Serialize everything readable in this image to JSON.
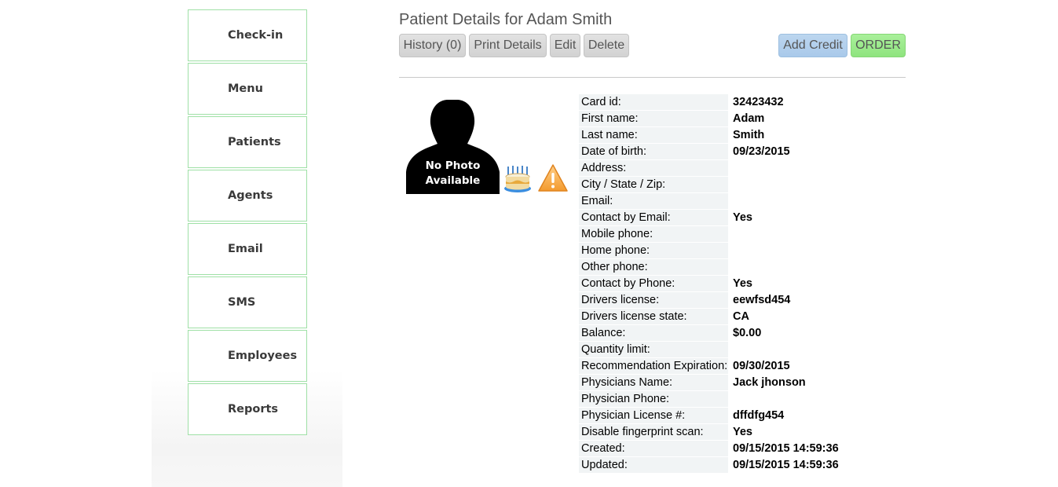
{
  "nav": {
    "items": [
      {
        "label": "Check-in"
      },
      {
        "label": "Menu"
      },
      {
        "label": "Patients"
      },
      {
        "label": "Agents"
      },
      {
        "label": "Email"
      },
      {
        "label": "SMS"
      },
      {
        "label": "Employees"
      },
      {
        "label": "Reports"
      }
    ]
  },
  "header": {
    "title": "Patient Details for Adam Smith"
  },
  "toolbar": {
    "history_label": "History (0)",
    "print_label": "Print Details",
    "edit_label": "Edit",
    "delete_label": "Delete",
    "add_credit_label": "Add Credit",
    "order_label": "ORDER"
  },
  "photo": {
    "line1": "No Photo",
    "line2": "Available"
  },
  "icons": {
    "birthday": "birthday-cake-icon",
    "warning": "warning-icon"
  },
  "colors": {
    "nav_border": "#9fe0a6",
    "add_credit": "#b3d0ee",
    "order": "#98ea88",
    "label_bg": "#f1f4f5"
  },
  "details": [
    {
      "label": "Card id:",
      "value": "32423432"
    },
    {
      "label": "First name:",
      "value": "Adam"
    },
    {
      "label": "Last name:",
      "value": "Smith"
    },
    {
      "label": "Date of birth:",
      "value": "09/23/2015"
    },
    {
      "label": "Address:",
      "value": ""
    },
    {
      "label": "City / State / Zip:",
      "value": ""
    },
    {
      "label": "Email:",
      "value": ""
    },
    {
      "label": "Contact by Email:",
      "value": "Yes"
    },
    {
      "label": "Mobile phone:",
      "value": ""
    },
    {
      "label": "Home phone:",
      "value": ""
    },
    {
      "label": "Other phone:",
      "value": ""
    },
    {
      "label": "Contact by Phone:",
      "value": "Yes"
    },
    {
      "label": "Drivers license:",
      "value": "eewfsd454"
    },
    {
      "label": "Drivers license state:",
      "value": "CA"
    },
    {
      "label": "Balance:",
      "value": "$0.00"
    },
    {
      "label": "Quantity limit:",
      "value": ""
    },
    {
      "label": "Recommendation Expiration:",
      "value": "09/30/2015"
    },
    {
      "label": "Physicians Name:",
      "value": "Jack jhonson"
    },
    {
      "label": "Physician Phone:",
      "value": ""
    },
    {
      "label": "Physician License #:",
      "value": "dffdfg454"
    },
    {
      "label": "Disable fingerprint scan:",
      "value": "Yes"
    },
    {
      "label": "Created:",
      "value": "09/15/2015 14:59:36"
    },
    {
      "label": "Updated:",
      "value": "09/15/2015 14:59:36"
    }
  ]
}
